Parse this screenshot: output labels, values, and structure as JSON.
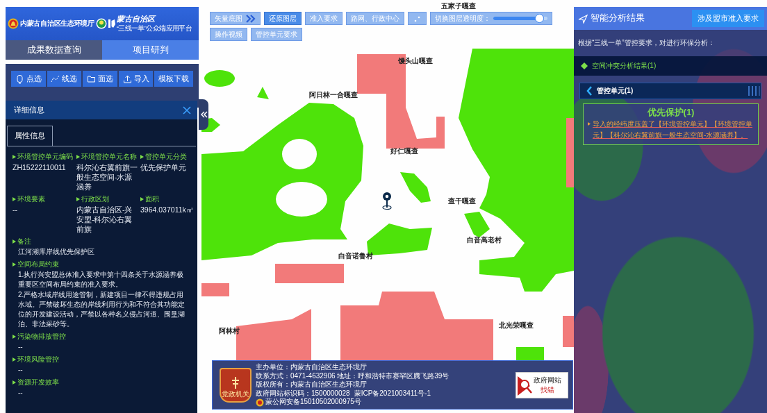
{
  "header": {
    "org_name": "内蒙古自治区生态环境厅",
    "logo_text": "蒙古自治区",
    "platform_subtitle": "“三线一单”公众端应用平台"
  },
  "main_tabs": [
    {
      "label": "成果数据查询",
      "selected": false
    },
    {
      "label": "项目研判",
      "selected": true
    }
  ],
  "tools": [
    {
      "label": "点选",
      "kind": "point"
    },
    {
      "label": "线选",
      "kind": "line"
    },
    {
      "label": "面选",
      "kind": "area"
    },
    {
      "label": "导入",
      "kind": "import"
    },
    {
      "label": "模板下载",
      "kind": "plain"
    }
  ],
  "detail": {
    "title": "详细信息",
    "tabs": [
      {
        "label": "属性信息",
        "selected": true
      }
    ],
    "fields": [
      {
        "label": "环境管控单元编码",
        "value": "ZH15222110011"
      },
      {
        "label": "环境管控单元名称",
        "value": "科尔沁右翼前旗一般生态空间-水源涵养"
      },
      {
        "label": "管控单元分类",
        "value": "优先保护单元"
      },
      {
        "label": "环境要素",
        "value": "--"
      },
      {
        "label": "行政区划",
        "value": "内蒙古自治区-兴安盟-科尔沁右翼前旗"
      },
      {
        "label": "面积",
        "value": "3964.037011k㎡"
      }
    ],
    "sections": [
      {
        "label": "备注",
        "paragraphs": [
          "江河湖库岸线优先保护区"
        ]
      },
      {
        "label": "空间布局约束",
        "paragraphs": [
          "1.执行兴安盟总体准入要求中第十四条关于水源涵养极重要区空间布局约束的准入要求。",
          "2.严格水域岸线用途管制，新建项目一律不得违规占用水域。严禁破坏生态的岸线利用行为和不符合其功能定位的开发建设活动，严禁以各种名义侵占河道、围垦湖泊、非法采砂等。"
        ]
      },
      {
        "label": "污染物排放管控",
        "paragraphs": [
          "--"
        ]
      },
      {
        "label": "环境风险管控",
        "paragraphs": [
          "--"
        ]
      },
      {
        "label": "资源开发效率",
        "paragraphs": [
          "--"
        ]
      }
    ]
  },
  "map_toolbar": {
    "buttons": [
      {
        "label": "矢量底图",
        "kind": "basemap",
        "selected": false
      },
      {
        "label": "还原图层",
        "kind": "text",
        "selected": true
      },
      {
        "label": "准入要求",
        "kind": "text",
        "selected": false
      },
      {
        "label": "路网、行政中心",
        "kind": "text",
        "selected": false
      },
      {
        "kind": "dots",
        "selected": false
      }
    ],
    "slider": {
      "label": "切换图层透明度：",
      "level": 0.93
    },
    "after": [
      {
        "label": "操作视频",
        "kind": "text",
        "selected": false
      },
      {
        "label": "管控单元要求",
        "kind": "text",
        "selected": false
      }
    ]
  },
  "map_labels": [
    "五家子嘎查",
    "馒头山嘎查",
    "阿日林一合嘎查",
    "好仁嘎查",
    "查干嘎查",
    "白音高老村",
    "白音诺鲁村",
    "阿林村",
    "北光荣嘎查"
  ],
  "analysis": {
    "title": "智能分析结果",
    "action": "涉及盟市准入要求",
    "intro": "根据“三线一单”管控要求，对进行环保分析：",
    "section": "空间冲突分析结果(1)",
    "subsection": "管控单元(1)",
    "result": {
      "title": "优先保护(1)",
      "text": "导入的经纬度压盖了【环境管控单元】【环境管控单元】【科尔沁右翼前旗一般生态空间-水源涵养】。"
    }
  },
  "footer": {
    "badge": "党政机关",
    "lines": [
      "主办单位：内蒙古自治区生态环境厅",
      "联系方式：0471-4632906 地址：呼和浩特市赛罕区腾飞路39号",
      "版权所有：内蒙古自治区生态环境厅"
    ],
    "site_code": "政府网站标识码：1500000028",
    "icp": "蒙ICP备2021003411号-1",
    "police": "蒙公网安备15010502000975号",
    "report": {
      "line1": "政府网站",
      "line2": "找错"
    }
  }
}
